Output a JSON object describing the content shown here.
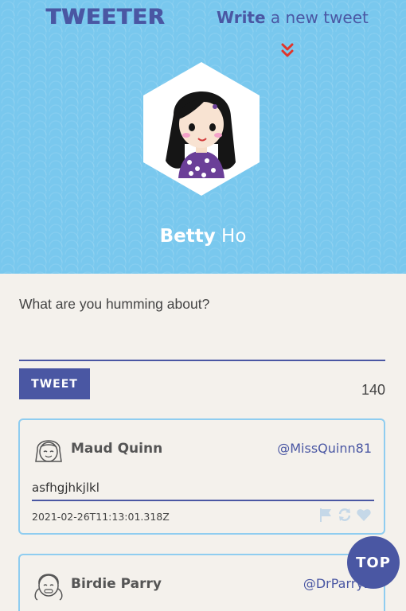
{
  "header": {
    "logo": "TWEETER",
    "write_strong": "Write",
    "write_rest": " a new tweet",
    "first_name": "Betty",
    "last_name": " Ho"
  },
  "compose": {
    "label": "What are you humming about?",
    "button": "TWEET",
    "counter": "140"
  },
  "tweets": [
    {
      "name": "Maud Quinn",
      "handle": "@MissQuinn81",
      "text": "asfhgjhkjlkl",
      "time": "2021-02-26T11:13:01.318Z"
    },
    {
      "name": "Birdie Parry",
      "handle": "@DrParry2"
    }
  ],
  "top_button": "TOP",
  "colors": {
    "header_bg": "#79c8ee",
    "brand": "#4a57a3",
    "accent_red": "#e0352b",
    "card_border": "#8fcdf0"
  }
}
